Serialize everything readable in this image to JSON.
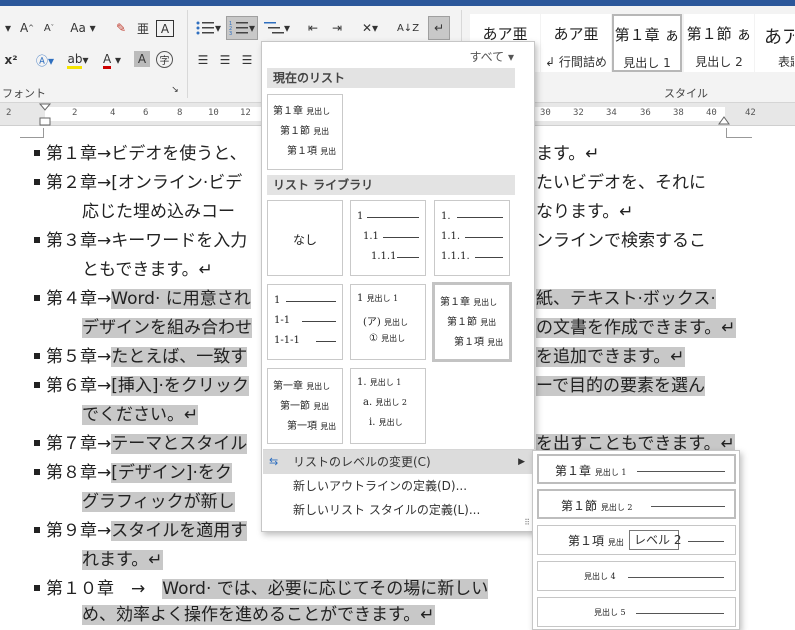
{
  "ribbon": {
    "font_group_label": "フォント",
    "style_group_label": "スタイル",
    "case_label": "Aa",
    "sort_label": "A↓Z",
    "superscript_label": "x²",
    "font_color_label": "A",
    "char_shading_label": "A",
    "phonetic_label": "字",
    "styles": [
      {
        "sample": "あア亜",
        "name": ""
      },
      {
        "sample": "あア亜",
        "name": "行間詰め"
      },
      {
        "sample": "第１章 ぁ",
        "name": "見出し 1"
      },
      {
        "sample": "第１節 ぁ",
        "name": "見出し 2"
      },
      {
        "sample": "あア",
        "name": "表題"
      }
    ]
  },
  "ruler": {
    "numbers": [
      "2",
      "2",
      "4",
      "6",
      "8",
      "10",
      "12",
      "30",
      "32",
      "34",
      "36",
      "38",
      "40",
      "42"
    ]
  },
  "document": {
    "lines": [
      {
        "pre": "第１章→ビデオを使うと、",
        "post": "ます。↵",
        "hl": ""
      },
      {
        "pre": "第２章→[オンライン·ビデ",
        "post": "たいビデオを、それに",
        "hl": ""
      },
      {
        "pre": "応じた埋め込みコー",
        "post": "なります。↵",
        "hl": ""
      },
      {
        "pre": "第３章→キーワードを入力",
        "post": "ンラインで検索するこ",
        "hl": ""
      },
      {
        "pre": "ともできます。↵",
        "post": "",
        "hl": ""
      },
      {
        "pre": "第４章→",
        "hl": "Word· に用意され",
        "post": "紙、テキスト·ボックス·"
      },
      {
        "pre": "",
        "hl": "デザインを組み合わせ",
        "post": "の文書を作成できます。↵"
      },
      {
        "pre": "第５章→",
        "hl": "たとえば、一致す",
        "post": "を追加できます。↵"
      },
      {
        "pre": "第６章→",
        "hl": "[挿入]·をクリック",
        "post": "ーで目的の要素を選ん"
      },
      {
        "pre": "",
        "hl": "でください。↵",
        "post": ""
      },
      {
        "pre": "第７章→",
        "hl": "テーマとスタイル",
        "post": "を出すこともできます。↵"
      },
      {
        "pre": "第８章→",
        "hl": "[デザイン]·をク",
        "post": ""
      },
      {
        "pre": "",
        "hl": "グラフィックが新し",
        "post": ""
      },
      {
        "pre": "第９章→",
        "hl": "スタイルを適用す",
        "post": ""
      },
      {
        "pre": "",
        "hl": "れます。↵",
        "post": ""
      },
      {
        "pre": "第１０章　→　",
        "hl": "Word· では、必要に応じてその場に新しい",
        "post": ""
      },
      {
        "pre": "",
        "hl": "め、効率よく操作を進めることができます。↵",
        "post": ""
      }
    ]
  },
  "panel": {
    "filter_label": "すべて ▾",
    "current_list_header": "現在のリスト",
    "library_header": "リスト ライブラリ",
    "none_label": "なし",
    "tiles": {
      "current": [
        "第１章",
        "見出し",
        "第１節",
        "見出",
        "第１項",
        "見出"
      ],
      "numeric": [
        "1",
        "1.1",
        "1.1.1"
      ],
      "numeric_dot": [
        "1.",
        "1.1.",
        "1.1.1."
      ],
      "dash": [
        "1",
        "1-1",
        "1-1-1"
      ],
      "paren": [
        "1",
        "見出し 1",
        "(ア)",
        "見出し",
        "①",
        "見出し"
      ],
      "chapter": [
        "第１章",
        "見出し",
        "第１節",
        "見出",
        "第１項",
        "見出"
      ],
      "chapter_arrow": [
        "第一章",
        "見出し",
        "第一節",
        "見出",
        "第一項",
        "見出"
      ],
      "alpha": [
        "1.",
        "見出し 1",
        "a.",
        "見出し 2",
        "i.",
        "見出し"
      ]
    },
    "menu": {
      "change_level": "リストのレベルの変更(C)",
      "define_outline": "新しいアウトラインの定義(D)...",
      "define_style": "新しいリスト スタイルの定義(L)..."
    }
  },
  "submenu": {
    "levels": [
      {
        "label": "第１章",
        "sub": "見出し 1"
      },
      {
        "label": "第１節",
        "sub": "見出し 2"
      },
      {
        "label": "第１項",
        "sub": "見出"
      },
      {
        "label": "",
        "sub": "見出し 4"
      },
      {
        "label": "",
        "sub": "見出し 5"
      }
    ],
    "tooltip": "レベル 2"
  }
}
